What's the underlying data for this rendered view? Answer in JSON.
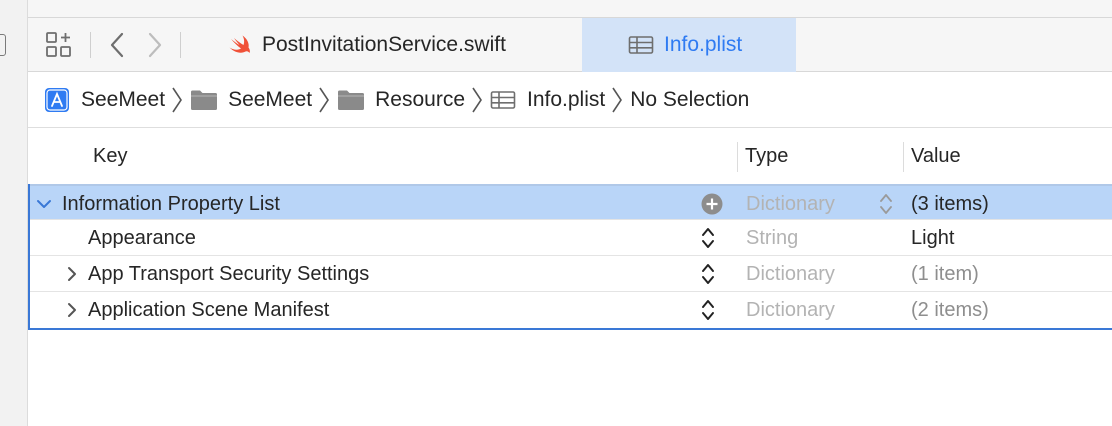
{
  "tabs": [
    {
      "label": "PostInvitationService.swift",
      "icon": "swift-icon",
      "active": false
    },
    {
      "label": "Info.plist",
      "icon": "plist-table-icon",
      "active": true
    }
  ],
  "breadcrumb": [
    {
      "label": "SeeMeet",
      "icon": "xcode-project-icon"
    },
    {
      "label": "SeeMeet",
      "icon": "folder-icon"
    },
    {
      "label": "Resource",
      "icon": "folder-icon"
    },
    {
      "label": "Info.plist",
      "icon": "plist-table-icon"
    },
    {
      "label": "No Selection",
      "icon": ""
    }
  ],
  "table": {
    "headers": {
      "key": "Key",
      "type": "Type",
      "value": "Value"
    },
    "rows": [
      {
        "key": "Information Property List",
        "type": "Dictionary",
        "value": "(3 items)",
        "expanded": true,
        "selected": true
      },
      {
        "key": "Appearance",
        "type": "String",
        "value": "Light",
        "expanded": false,
        "selected": false
      },
      {
        "key": "App Transport Security Settings",
        "type": "Dictionary",
        "value": "(1 item)",
        "expanded": false,
        "selected": false
      },
      {
        "key": "Application Scene Manifest",
        "type": "Dictionary",
        "value": "(2 items)",
        "expanded": false,
        "selected": false
      }
    ]
  },
  "colors": {
    "accent": "#2f7bf2",
    "selection": "#b9d5f8",
    "swift": "#f05138"
  }
}
